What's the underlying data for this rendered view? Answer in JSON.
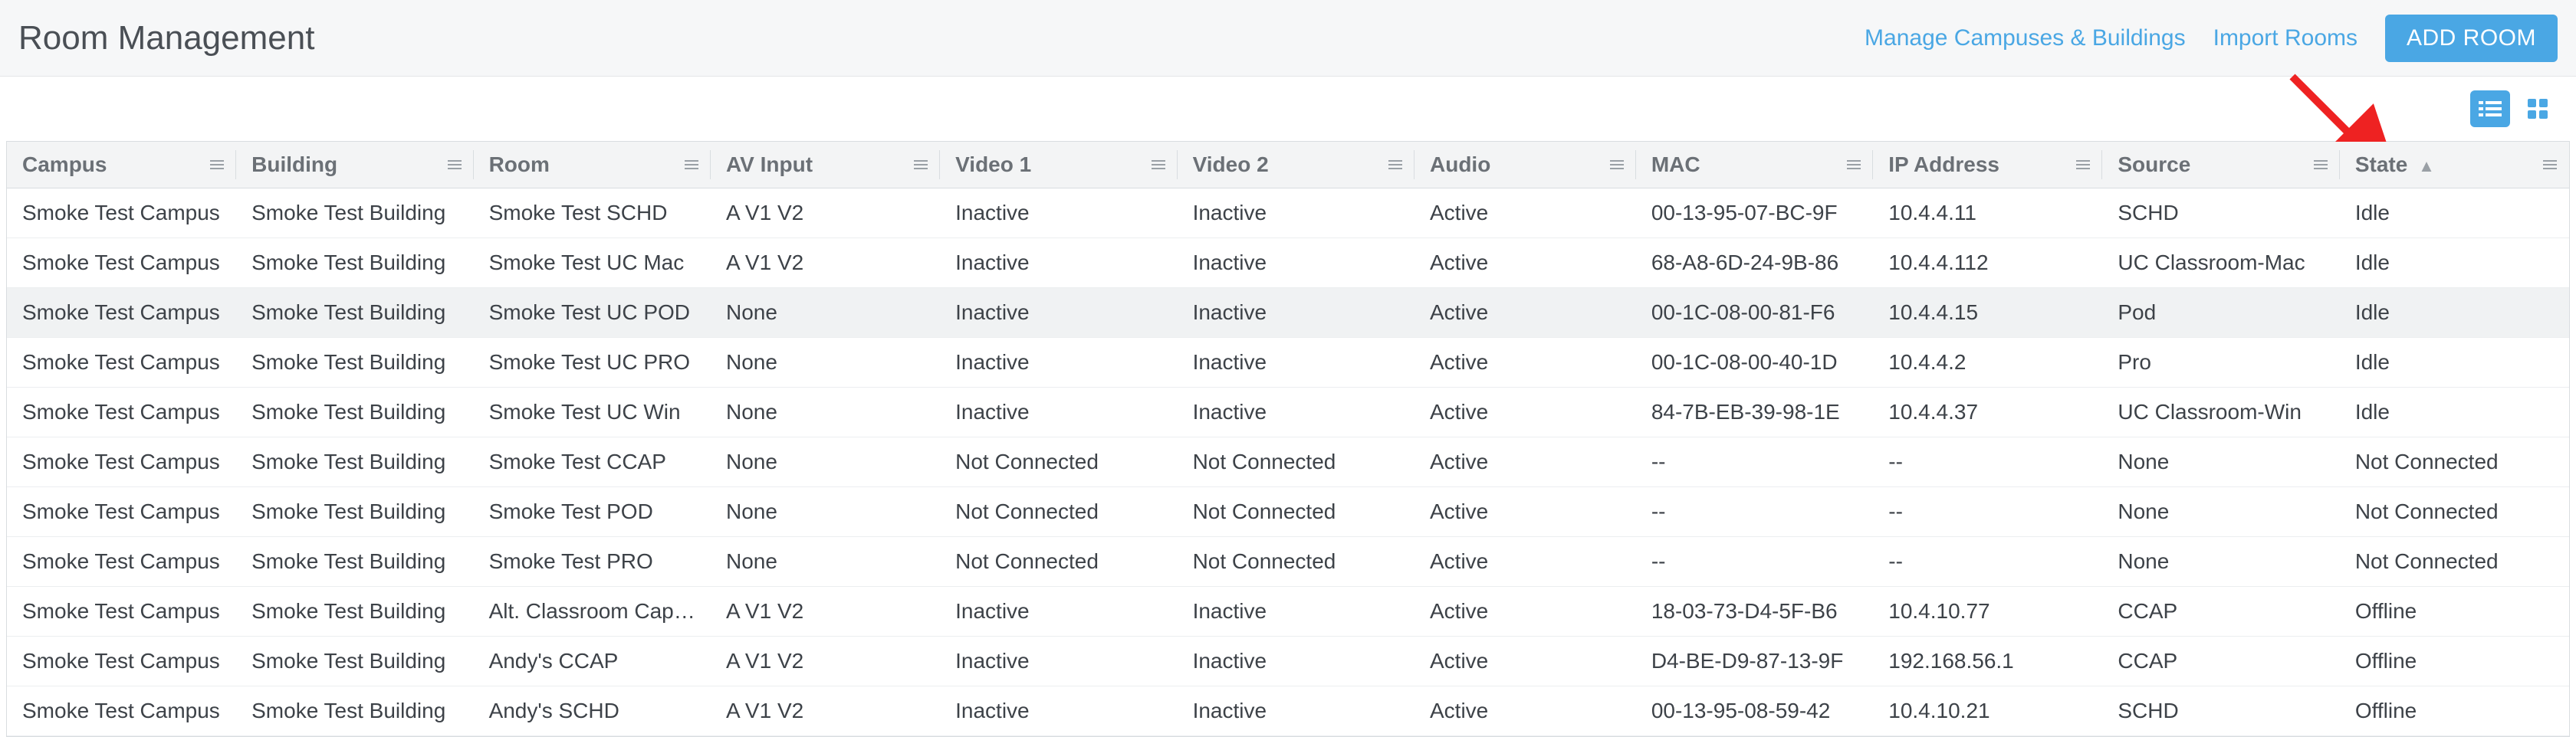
{
  "header": {
    "title": "Room Management",
    "manage_link": "Manage Campuses & Buildings",
    "import_link": "Import Rooms",
    "add_button": "ADD ROOM"
  },
  "columns": {
    "campus": "Campus",
    "building": "Building",
    "room": "Room",
    "av": "AV Input",
    "v1": "Video 1",
    "v2": "Video 2",
    "audio": "Audio",
    "mac": "MAC",
    "ip": "IP Address",
    "source": "Source",
    "state": "State"
  },
  "state_sort_dir": "asc",
  "rows": [
    {
      "campus": "Smoke Test Campus",
      "building": "Smoke Test Building",
      "room": "Smoke Test SCHD",
      "av": "A V1 V2",
      "v1": "Inactive",
      "v2": "Inactive",
      "audio": "Active",
      "mac": "00-13-95-07-BC-9F",
      "ip": "10.4.4.11",
      "source": "SCHD",
      "state": "Idle",
      "highlight": false
    },
    {
      "campus": "Smoke Test Campus",
      "building": "Smoke Test Building",
      "room": "Smoke Test UC Mac",
      "av": "A V1 V2",
      "v1": "Inactive",
      "v2": "Inactive",
      "audio": "Active",
      "mac": "68-A8-6D-24-9B-86",
      "ip": "10.4.4.112",
      "source": "UC Classroom-Mac",
      "state": "Idle",
      "highlight": false
    },
    {
      "campus": "Smoke Test Campus",
      "building": "Smoke Test Building",
      "room": "Smoke Test UC POD",
      "av": "None",
      "v1": "Inactive",
      "v2": "Inactive",
      "audio": "Active",
      "mac": "00-1C-08-00-81-F6",
      "ip": "10.4.4.15",
      "source": "Pod",
      "state": "Idle",
      "highlight": true
    },
    {
      "campus": "Smoke Test Campus",
      "building": "Smoke Test Building",
      "room": "Smoke Test UC PRO",
      "av": "None",
      "v1": "Inactive",
      "v2": "Inactive",
      "audio": "Active",
      "mac": "00-1C-08-00-40-1D",
      "ip": "10.4.4.2",
      "source": "Pro",
      "state": "Idle",
      "highlight": false
    },
    {
      "campus": "Smoke Test Campus",
      "building": "Smoke Test Building",
      "room": "Smoke Test UC Win",
      "av": "None",
      "v1": "Inactive",
      "v2": "Inactive",
      "audio": "Active",
      "mac": "84-7B-EB-39-98-1E",
      "ip": "10.4.4.37",
      "source": "UC Classroom-Win",
      "state": "Idle",
      "highlight": false
    },
    {
      "campus": "Smoke Test Campus",
      "building": "Smoke Test Building",
      "room": "Smoke Test CCAP",
      "av": "None",
      "v1": "Not Connected",
      "v2": "Not Connected",
      "audio": "Active",
      "mac": "--",
      "ip": "--",
      "source": "None",
      "state": "Not Connected",
      "highlight": false
    },
    {
      "campus": "Smoke Test Campus",
      "building": "Smoke Test Building",
      "room": "Smoke Test POD",
      "av": "None",
      "v1": "Not Connected",
      "v2": "Not Connected",
      "audio": "Active",
      "mac": "--",
      "ip": "--",
      "source": "None",
      "state": "Not Connected",
      "highlight": false
    },
    {
      "campus": "Smoke Test Campus",
      "building": "Smoke Test Building",
      "room": "Smoke Test PRO",
      "av": "None",
      "v1": "Not Connected",
      "v2": "Not Connected",
      "audio": "Active",
      "mac": "--",
      "ip": "--",
      "source": "None",
      "state": "Not Connected",
      "highlight": false
    },
    {
      "campus": "Smoke Test Campus",
      "building": "Smoke Test Building",
      "room": "Alt. Classroom Capt...",
      "av": "A V1 V2",
      "v1": "Inactive",
      "v2": "Inactive",
      "audio": "Active",
      "mac": "18-03-73-D4-5F-B6",
      "ip": "10.4.10.77",
      "source": "CCAP",
      "state": "Offline",
      "highlight": false
    },
    {
      "campus": "Smoke Test Campus",
      "building": "Smoke Test Building",
      "room": "Andy's CCAP",
      "av": "A V1 V2",
      "v1": "Inactive",
      "v2": "Inactive",
      "audio": "Active",
      "mac": "D4-BE-D9-87-13-9F",
      "ip": "192.168.56.1",
      "source": "CCAP",
      "state": "Offline",
      "highlight": false
    },
    {
      "campus": "Smoke Test Campus",
      "building": "Smoke Test Building",
      "room": "Andy's SCHD",
      "av": "A V1 V2",
      "v1": "Inactive",
      "v2": "Inactive",
      "audio": "Active",
      "mac": "00-13-95-08-59-42",
      "ip": "10.4.10.21",
      "source": "SCHD",
      "state": "Offline",
      "highlight": false
    }
  ]
}
